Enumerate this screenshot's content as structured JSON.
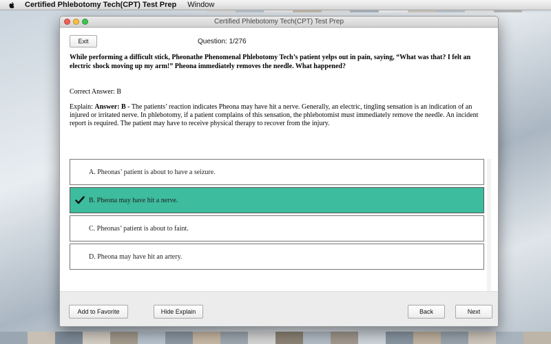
{
  "menubar": {
    "app_name": "Certified Phlebotomy Tech(CPT) Test Prep",
    "items": [
      "Window"
    ]
  },
  "window": {
    "title": "Certified Phlebotomy Tech(CPT) Test Prep"
  },
  "toolbar": {
    "exit_label": "Exit",
    "question_counter": "Question:  1/276"
  },
  "question": {
    "text": "While performing a difficult stick, Pheonathe Phenomenal Phlebotomy Tech’s patient yelps out in pain, saying, “What was that? I felt an electric shock moving up my arm!” Pheona immediately removes the needle. What happened?",
    "correct_answer": "Correct Answer: B",
    "explain_prefix": "Explain: ",
    "explain_answer": "Answer: B -",
    "explain_body": " The patients’ reaction indicates Pheona may have hit a nerve. Generally, an electric, tingling sensation is an indication of an injured or irritated nerve. In phlebotomy, if a patient complains of this sensation, the phlebotomist must immediately remove the needle. An incident report is required. The patient may have to receive physical therapy to recover from the injury."
  },
  "options": [
    {
      "label": "A. Pheonas’ patient is about to have a seizure.",
      "selected": false
    },
    {
      "label": "B. Pheona may have hit a nerve.",
      "selected": true
    },
    {
      "label": "C. Pheonas’ patient is about to faint.",
      "selected": false
    },
    {
      "label": "D. Pheona may have hit an artery.",
      "selected": false
    }
  ],
  "footer": {
    "favorite_label": "Add to Favorite",
    "hide_explain_label": "Hide Explain",
    "back_label": "Back",
    "next_label": "Next"
  },
  "colors": {
    "selected_option": "#3dbc9e",
    "window_bg": "#ececec"
  },
  "icons": {
    "apple": "apple-icon",
    "check": "check-icon"
  }
}
